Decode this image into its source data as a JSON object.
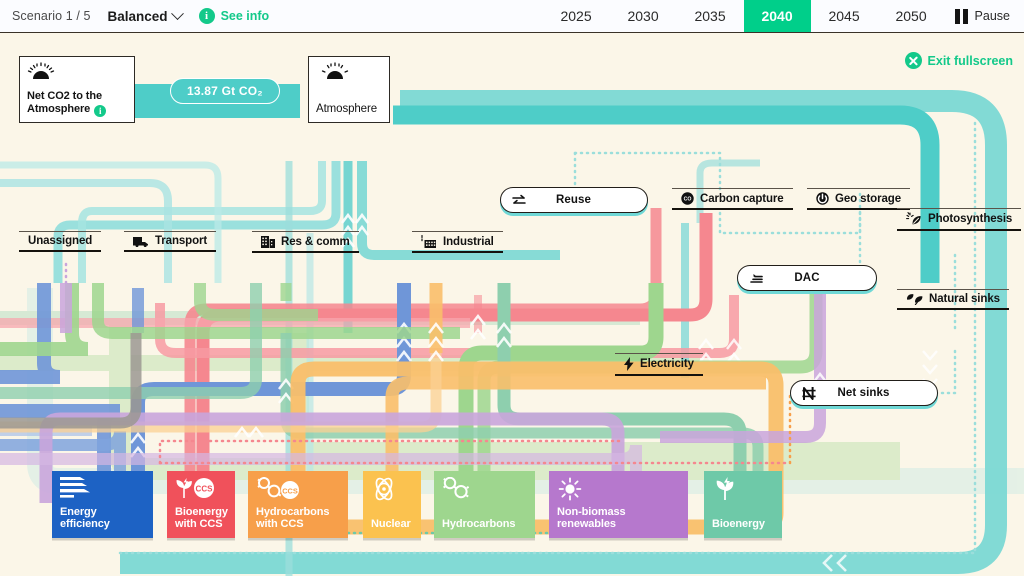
{
  "header": {
    "scenario_label": "Scenario 1 / 5",
    "pathway": "Balanced",
    "chevron_icon": "chevron-down-icon",
    "info_badge": "i",
    "see_info": "See info",
    "years": [
      "2025",
      "2030",
      "2035",
      "2040",
      "2045",
      "2050"
    ],
    "active_year": "2040",
    "pause_label": "Pause",
    "pause_icon": "pause-icon",
    "accent_green": "#00cf8a"
  },
  "canvas": {
    "background": "#fbf6e8",
    "exit_fullscreen": "Exit fullscreen",
    "exit_icon": "close-circle-icon"
  },
  "nodes": {
    "net_co2": {
      "label": "Net CO2 to the",
      "label2": "Atmosphere",
      "icon": "sunrise-icon",
      "info": "i"
    },
    "atmosphere": {
      "label": "Atmosphere",
      "icon": "sunrise-icon"
    },
    "value_badge": {
      "text": "13.87 Gt CO₂",
      "color": "#4ecdc8"
    }
  },
  "sectors": [
    {
      "label": "Unassigned",
      "icon": "none"
    },
    {
      "label": "Transport",
      "icon": "truck-icon"
    },
    {
      "label": "Res & comm",
      "icon": "building-icon"
    },
    {
      "label": "Industrial",
      "icon": "factory-icon"
    },
    {
      "label": "Electricity",
      "icon": "bolt-icon"
    }
  ],
  "carbon_nodes": [
    {
      "label": "Reuse",
      "icon": "exchange-arrows-icon",
      "style": "pill"
    },
    {
      "label": "Carbon capture",
      "icon": "co2-circle-icon",
      "style": "underline"
    },
    {
      "label": "Geo storage",
      "icon": "geo-storage-icon",
      "style": "underline"
    },
    {
      "label": "DAC",
      "icon": "dac-icon",
      "style": "pill"
    },
    {
      "label": "Photosynthesis",
      "icon": "photosynthesis-icon",
      "style": "underline"
    },
    {
      "label": "Natural sinks",
      "icon": "leaf-icon",
      "style": "underline"
    },
    {
      "label": "Net sinks",
      "icon": "net-sinks-icon",
      "style": "pill"
    }
  ],
  "tech_cards": [
    {
      "label": "Energy",
      "label2": "efficiency",
      "color": "#1d62c4",
      "icon": "efficiency-bars-icon"
    },
    {
      "label": "Bioenergy",
      "label2": "with CCS",
      "color": "#f0515b",
      "icon": "bioenergy-ccs-icon"
    },
    {
      "label": "Hydrocarbons",
      "label2": "with CCS",
      "color": "#f79f4a",
      "icon": "hydrocarbons-ccs-icon"
    },
    {
      "label": "Nuclear",
      "label2": "",
      "color": "#fbc24f",
      "icon": "atom-icon"
    },
    {
      "label": "Hydrocarbons",
      "label2": "",
      "color": "#9ed68e",
      "icon": "molecule-icon"
    },
    {
      "label": "Non-biomass",
      "label2": "renewables",
      "color": "#b678cd",
      "icon": "sun-icon"
    },
    {
      "label": "Bioenergy",
      "label2": "",
      "color": "#6ec9a8",
      "icon": "plant-icon"
    }
  ],
  "flow_colors": {
    "teal": "#4ecdc8",
    "teal_light": "#b8e6e4",
    "blue": "#6f96d8",
    "green": "#9ed68e",
    "green_soft": "#8ecfae",
    "red": "#f5878f",
    "orange": "#f9bf6a",
    "purple": "#c9a5dc",
    "grey": "#9b9892"
  }
}
